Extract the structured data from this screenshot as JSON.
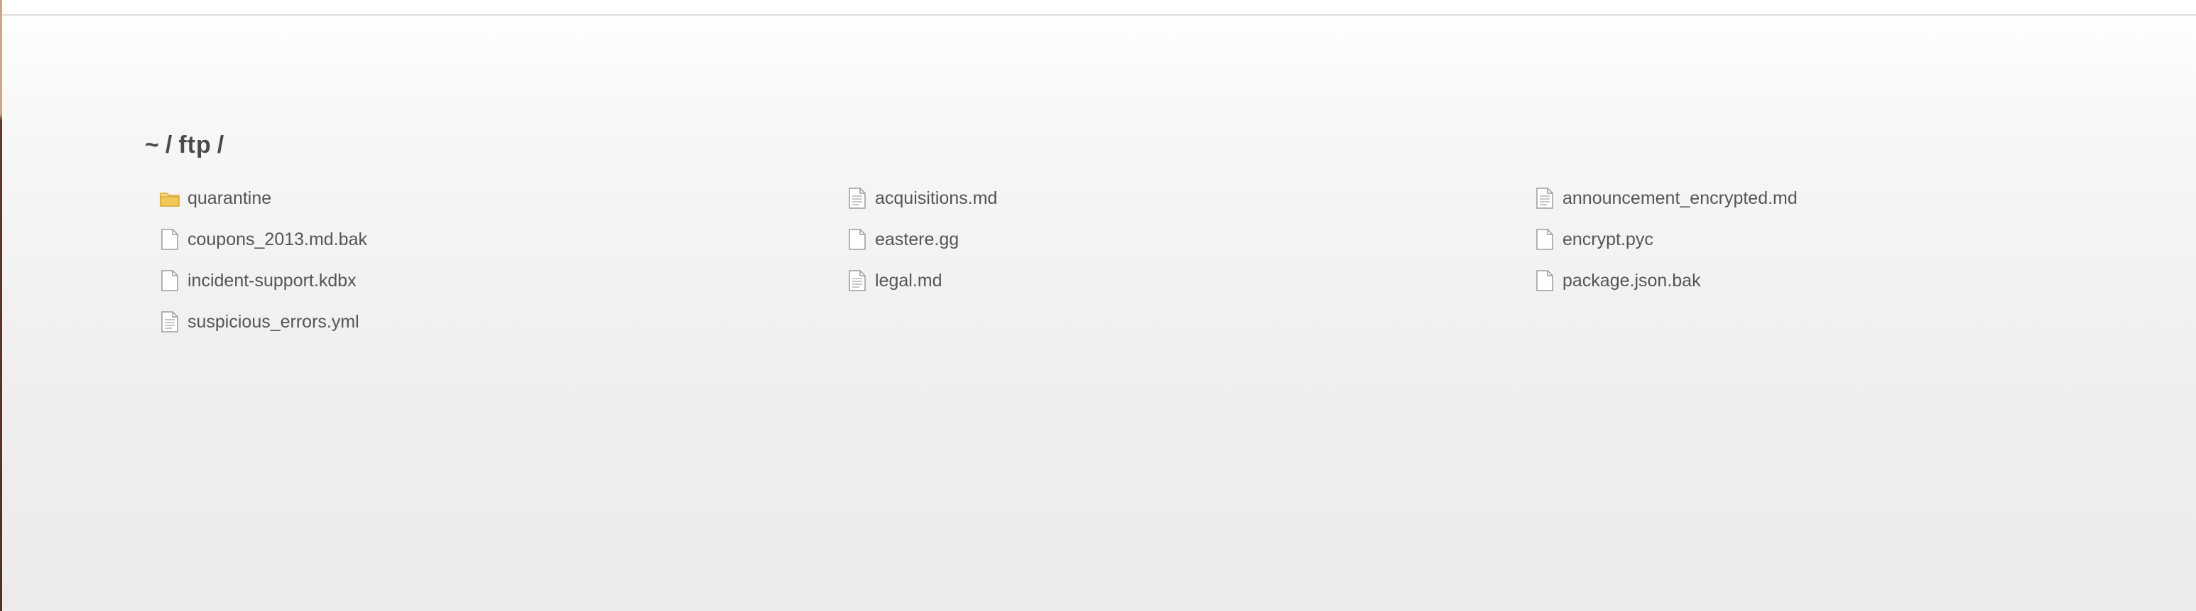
{
  "breadcrumb": {
    "parts": [
      "~",
      "/",
      "ftp",
      "/"
    ]
  },
  "files": [
    {
      "name": "quarantine",
      "icon": "folder-icon"
    },
    {
      "name": "acquisitions.md",
      "icon": "text-file-icon"
    },
    {
      "name": "announcement_encrypted.md",
      "icon": "text-file-icon"
    },
    {
      "name": "coupons_2013.md.bak",
      "icon": "file-icon"
    },
    {
      "name": "eastere.gg",
      "icon": "file-icon"
    },
    {
      "name": "encrypt.pyc",
      "icon": "file-icon"
    },
    {
      "name": "incident-support.kdbx",
      "icon": "file-icon"
    },
    {
      "name": "legal.md",
      "icon": "text-file-icon"
    },
    {
      "name": "package.json.bak",
      "icon": "file-icon"
    },
    {
      "name": "suspicious_errors.yml",
      "icon": "text-file-icon"
    }
  ],
  "colors": {
    "text": "#555555",
    "heading": "#4a4a4a",
    "folder": "#f2c75a"
  }
}
